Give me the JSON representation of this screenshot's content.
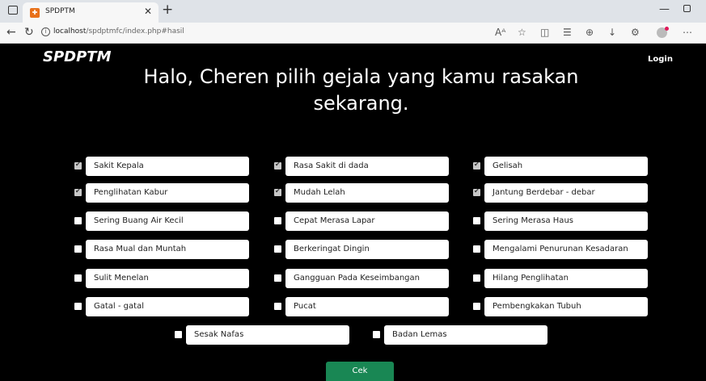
{
  "browser": {
    "tab_title": "SPDPTM",
    "url_host": "localhost",
    "url_path": "/spdptmfc/index.php#hasil"
  },
  "page": {
    "brand": "SPDPTM",
    "login_label": "Login",
    "heading_line1": "Halo, Cheren pilih gejala yang kamu rasakan",
    "heading_line2": "sekarang.",
    "submit_label": "Cek"
  },
  "symptoms": [
    {
      "label": "Sakit Kepala",
      "checked": true
    },
    {
      "label": "Rasa Sakit di dada",
      "checked": true
    },
    {
      "label": "Gelisah",
      "checked": true
    },
    {
      "label": "Penglihatan Kabur",
      "checked": true
    },
    {
      "label": "Mudah Lelah",
      "checked": true
    },
    {
      "label": "Jantung Berdebar - debar",
      "checked": true
    },
    {
      "label": "Sering Buang Air Kecil",
      "checked": false
    },
    {
      "label": "Cepat Merasa Lapar",
      "checked": false
    },
    {
      "label": "Sering Merasa Haus",
      "checked": false
    },
    {
      "label": "Rasa Mual dan Muntah",
      "checked": false
    },
    {
      "label": "Berkeringat Dingin",
      "checked": false
    },
    {
      "label": "Mengalami Penurunan Kesadaran",
      "checked": false
    },
    {
      "label": "Sulit Menelan",
      "checked": false
    },
    {
      "label": "Gangguan Pada Keseimbangan",
      "checked": false
    },
    {
      "label": "Hilang Penglihatan",
      "checked": false
    },
    {
      "label": "Gatal - gatal",
      "checked": false
    },
    {
      "label": "Pucat",
      "checked": false
    },
    {
      "label": "Pembengkakan Tubuh",
      "checked": false
    },
    {
      "label": "Sesak Nafas",
      "checked": false
    },
    {
      "label": "Badan Lemas",
      "checked": false
    }
  ]
}
